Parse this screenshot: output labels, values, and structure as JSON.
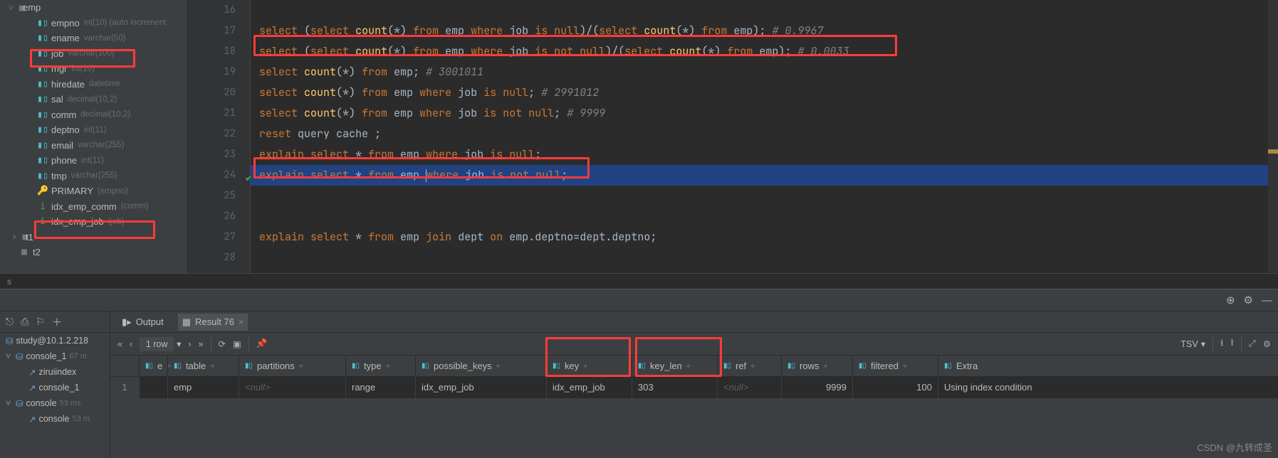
{
  "tree": {
    "root": {
      "name": "emp"
    },
    "cols": [
      {
        "name": "empno",
        "meta": "int(10) (auto increment"
      },
      {
        "name": "ename",
        "meta": "varchar(50)"
      },
      {
        "name": "job",
        "meta": "varchar(100)"
      },
      {
        "name": "mgr",
        "meta": "int(10)"
      },
      {
        "name": "hiredate",
        "meta": "datetime"
      },
      {
        "name": "sal",
        "meta": "decimal(10,2)"
      },
      {
        "name": "comm",
        "meta": "decimal(10,2)"
      },
      {
        "name": "deptno",
        "meta": "int(11)"
      },
      {
        "name": "email",
        "meta": "varchar(255)"
      },
      {
        "name": "phone",
        "meta": "int(11)"
      },
      {
        "name": "tmp",
        "meta": "varchar(255)"
      }
    ],
    "keys": [
      {
        "type": "key",
        "name": "PRIMARY",
        "meta": "(empno)"
      },
      {
        "type": "idx",
        "name": "idx_emp_comm",
        "meta": "(comm)"
      },
      {
        "type": "idx",
        "name": "idx_emp_job",
        "meta": "(job)"
      }
    ],
    "tables": [
      {
        "name": "t1"
      },
      {
        "name": "t2"
      }
    ]
  },
  "code": {
    "l16": "",
    "l17": {
      "a": "select",
      "b": "select",
      "c": "count",
      "d": "from",
      "e": "emp",
      "f": "where",
      "g": "job",
      "h": "is null",
      "i": "select",
      "j": "count",
      "k": "from",
      "l": "emp",
      "m": "# 0.9967"
    },
    "l18": {
      "a": "select",
      "b": "select",
      "c": "count",
      "d": "from",
      "e": "emp",
      "f": "where",
      "g": "job",
      "h": "is not null",
      "i": "select",
      "j": "count",
      "k": "from",
      "l": "emp",
      "m": "# 0.0033"
    },
    "l19": {
      "a": "select",
      "b": "count",
      "c": "from",
      "d": "emp",
      "e": "# 3001011"
    },
    "l20": {
      "a": "select",
      "b": "count",
      "c": "from",
      "d": "emp",
      "e": "where",
      "f": "job",
      "g": "is null",
      "h": "# 2991012"
    },
    "l21": {
      "a": "select",
      "b": "count",
      "c": "from",
      "d": "emp",
      "e": "where",
      "f": "job",
      "g": "is not null",
      "h": "# 9999"
    },
    "l22": {
      "a": "reset",
      "b": "query",
      "c": "cache"
    },
    "l23": {
      "a": "explain",
      "b": "select",
      "c": "from",
      "d": "emp",
      "e": "where",
      "f": "job",
      "g": "is null"
    },
    "l24": {
      "a": "explain",
      "b": "select",
      "c": "from",
      "d": "emp",
      "e": "where",
      "f": "job",
      "g": "is not null"
    },
    "l27": {
      "a": "explain",
      "b": "select",
      "c": "from",
      "d": "emp",
      "e": "join",
      "f": "dept",
      "g": "on",
      "h": "emp",
      "i": "deptno",
      "j": "dept",
      "k": "deptno"
    }
  },
  "gutter": [
    "16",
    "17",
    "18",
    "19",
    "20",
    "21",
    "22",
    "23",
    "24",
    "25",
    "26",
    "27",
    "28"
  ],
  "tab_label": "s",
  "left_tree": {
    "source": "study@10.1.2.218",
    "console1": "console_1",
    "console1_meta": "67 m",
    "zirui": "ziruiindex",
    "console1b": "console_1",
    "console": "console",
    "console_meta": "53 ms",
    "console_b": "console",
    "console_b_meta": "53 m"
  },
  "tabs": {
    "output": "Output",
    "result": "Result 76"
  },
  "toolbar": {
    "rows": "1 row",
    "tsv": "TSV"
  },
  "grid": {
    "headers": [
      "e",
      "table",
      "partitions",
      "type",
      "possible_keys",
      "key",
      "key_len",
      "ref",
      "rows",
      "filtered",
      "Extra"
    ],
    "row0": "1",
    "row": [
      "",
      "emp",
      "<null>",
      "range",
      "idx_emp_job",
      "idx_emp_job",
      "303",
      "<null>",
      "9999",
      "100",
      "Using index condition"
    ]
  },
  "watermark": "CSDN @九转成圣"
}
